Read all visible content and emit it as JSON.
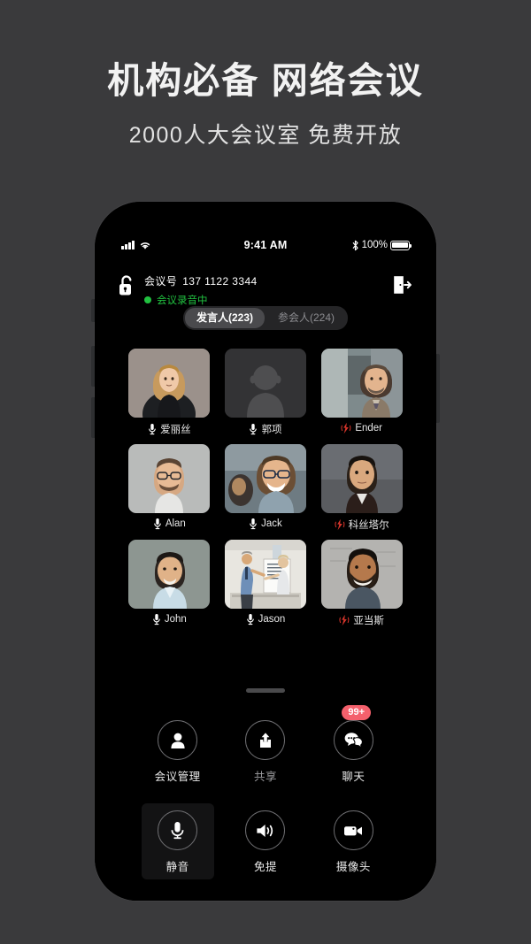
{
  "promo": {
    "title": "机构必备 网络会议",
    "subtitle": "2000人大会议室 免费开放"
  },
  "phone": {
    "statusbar": {
      "signal_icon": "signal-bars-icon",
      "wifi_icon": "wifi-icon",
      "time": "9:41 AM",
      "bluetooth_icon": "bluetooth-icon",
      "battery_percent": "100%",
      "battery_icon": "battery-full-icon"
    },
    "header": {
      "lock_icon": "unlocked-lock-icon",
      "meeting_no_label": "会议号",
      "meeting_no_value": "137 1122 3344",
      "recording_text": "会议录音中",
      "recording_color": "#21c140",
      "exit_icon": "exit-door-icon"
    },
    "tabs": [
      {
        "label": "发言人(223)",
        "active": true
      },
      {
        "label": "参会人(224)",
        "active": false
      }
    ],
    "participants": [
      {
        "name": "爱丽丝",
        "mic": "mic-icon",
        "speaking": false,
        "avatar": "woman-blonde-black-top"
      },
      {
        "name": "郭项",
        "mic": "mic-icon",
        "speaking": false,
        "avatar": "placeholder-silhouette"
      },
      {
        "name": "Ender",
        "mic": "speaking-icon",
        "speaking": true,
        "avatar": "man-beard-office"
      },
      {
        "name": "Alan",
        "mic": "mic-icon",
        "speaking": false,
        "avatar": "man-glasses-gray-bg"
      },
      {
        "name": "Jack",
        "mic": "mic-icon",
        "speaking": false,
        "avatar": "man-glasses-smiling"
      },
      {
        "name": "科丝塔尔",
        "mic": "speaking-icon",
        "speaking": true,
        "avatar": "man-dark-hair-suit"
      },
      {
        "name": "John",
        "mic": "mic-icon",
        "speaking": false,
        "avatar": "man-asian-blue-shirt"
      },
      {
        "name": "Jason",
        "mic": "mic-icon",
        "speaking": false,
        "avatar": "presentation-whiteboard"
      },
      {
        "name": "亚当斯",
        "mic": "speaking-icon",
        "speaking": true,
        "avatar": "man-beard-smiling"
      }
    ],
    "speaking_color": "#d9352b",
    "toolbar": [
      {
        "label": "会议管理",
        "icon": "person-icon",
        "dim": false,
        "highlight": false,
        "badge": null
      },
      {
        "label": "共享",
        "icon": "share-upload-icon",
        "dim": true,
        "highlight": false,
        "badge": null
      },
      {
        "label": "聊天",
        "icon": "chat-bubble-icon",
        "dim": false,
        "highlight": false,
        "badge": "99+"
      },
      {
        "label": "静音",
        "icon": "microphone-icon",
        "dim": false,
        "highlight": true,
        "badge": null
      },
      {
        "label": "免提",
        "icon": "speaker-icon",
        "dim": false,
        "highlight": false,
        "badge": null
      },
      {
        "label": "摄像头",
        "icon": "video-camera-icon",
        "dim": false,
        "highlight": false,
        "badge": null
      }
    ]
  }
}
